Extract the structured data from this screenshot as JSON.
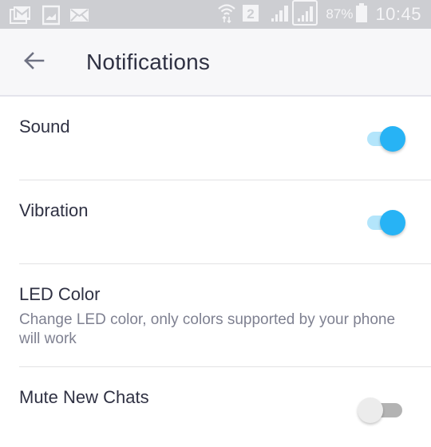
{
  "status_bar": {
    "left_icons": [
      "gmail-icon",
      "gallery-icon",
      "email-icon"
    ],
    "right_icons": [
      "wifi-icon",
      "sim2-icon",
      "signal-icon",
      "signal-icon"
    ],
    "sim_label": "2",
    "battery_percent": "87%",
    "time": "10:45"
  },
  "app_bar": {
    "back_icon": "arrow-left-icon",
    "title": "Notifications"
  },
  "settings": [
    {
      "id": "sound",
      "label": "Sound",
      "toggle": true,
      "value": true
    },
    {
      "id": "vibration",
      "label": "Vibration",
      "toggle": true,
      "value": true
    },
    {
      "id": "led-color",
      "label": "LED Color",
      "subtitle": "Change LED color, only colors supported by your phone will work",
      "toggle": false
    },
    {
      "id": "mute-new-chats",
      "label": "Mute New Chats",
      "toggle": true,
      "value": false
    }
  ],
  "colors": {
    "accent": "#27b3f5",
    "accent_track": "#b3e5fb",
    "off_thumb": "#ececec",
    "off_track": "#b3b3b3",
    "title_text": "#2f3143",
    "subtitle_text": "#7f8191",
    "status_bar_bg": "#cdced2"
  }
}
